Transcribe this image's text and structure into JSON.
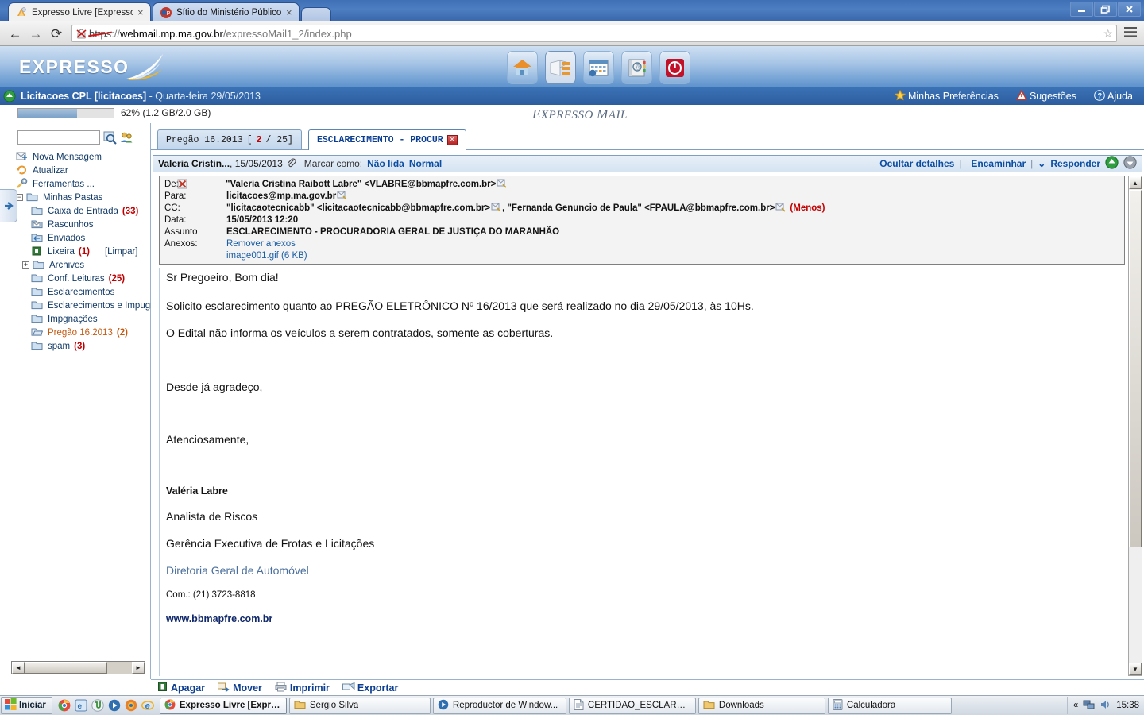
{
  "browser": {
    "tabs": [
      {
        "title": "Expresso Livre [Expresso Ma",
        "favicon": "expresso-favicon",
        "active": true,
        "close": "×"
      },
      {
        "title": "Sítio do Ministério Público do",
        "favicon": "mp-favicon",
        "active": false,
        "close": "×"
      }
    ],
    "newtab_label": "",
    "window_controls": {
      "minimize": "–",
      "maximize": "❐",
      "close": "✕"
    },
    "nav": {
      "back": "←",
      "forward": "→",
      "reload": "⟳"
    },
    "url": {
      "scheme": "https",
      "separator": "://",
      "host": "webmail.mp.ma.gov.br",
      "path": "/expressoMail1_2/index.php"
    },
    "bookmark_star": "☆",
    "menu": "☰"
  },
  "header": {
    "logo_text": "EXPRESSO",
    "toolbar_icons": [
      {
        "name": "home-icon",
        "selected": false
      },
      {
        "name": "mail-icon",
        "selected": true
      },
      {
        "name": "calendar-icon",
        "selected": false
      },
      {
        "name": "addressbook-icon",
        "selected": false
      },
      {
        "name": "logout-icon",
        "selected": false
      }
    ],
    "user": "Licitacoes CPL [licitacoes]",
    "date": " - Quarta-feira 29/05/2013",
    "links": [
      {
        "label": "Minhas Preferências",
        "icon": "star-icon"
      },
      {
        "label": "Sugestões",
        "icon": "warning-icon"
      },
      {
        "label": "Ajuda",
        "icon": "help-icon"
      }
    ]
  },
  "quota": {
    "percent": 62,
    "text": "62% (1.2 GB/2.0 GB)",
    "watermark_1": "E",
    "watermark_2": "XPRESSO ",
    "watermark_3": "M",
    "watermark_4": "AIL"
  },
  "sidebar": {
    "search_placeholder": "",
    "search_value": "",
    "icons": {
      "search": "search-icon",
      "contacts": "contacts-icon"
    },
    "items": [
      {
        "label": "Nova Mensagem",
        "icon": "new-message-icon",
        "indent": 0,
        "tree": "",
        "count": "",
        "extra": ""
      },
      {
        "label": "Atualizar",
        "icon": "refresh-icon",
        "indent": 0,
        "tree": "",
        "count": "",
        "extra": ""
      },
      {
        "label": "Ferramentas ...",
        "icon": "tools-icon",
        "indent": 0,
        "tree": "",
        "count": "",
        "extra": ""
      },
      {
        "label": "Minhas Pastas",
        "icon": "folder-icon",
        "indent": 0,
        "tree": "−",
        "count": "",
        "extra": ""
      },
      {
        "label": "Caixa de Entrada",
        "icon": "folder-icon",
        "indent": 1,
        "tree": "",
        "count": "(33)",
        "extra": ""
      },
      {
        "label": "Rascunhos",
        "icon": "drafts-icon",
        "indent": 1,
        "tree": "",
        "count": "",
        "extra": ""
      },
      {
        "label": "Enviados",
        "icon": "sent-icon",
        "indent": 1,
        "tree": "",
        "count": "",
        "extra": ""
      },
      {
        "label": "Lixeira",
        "icon": "trash-icon",
        "indent": 1,
        "tree": "",
        "count": "(1)",
        "extra": "[Limpar]"
      },
      {
        "label": "Archives",
        "icon": "folder-icon",
        "indent": 1,
        "tree": "+",
        "count": "",
        "extra": ""
      },
      {
        "label": "Conf. Leituras",
        "icon": "folder-icon",
        "indent": 1,
        "tree": "",
        "count": "(25)",
        "extra": ""
      },
      {
        "label": "Esclarecimentos",
        "icon": "folder-icon",
        "indent": 1,
        "tree": "",
        "count": "",
        "extra": ""
      },
      {
        "label": "Esclarecimentos e Impugr",
        "icon": "folder-icon",
        "indent": 1,
        "tree": "",
        "count": "",
        "extra": ""
      },
      {
        "label": "Impgnações",
        "icon": "folder-icon",
        "indent": 1,
        "tree": "",
        "count": "",
        "extra": ""
      },
      {
        "label": "Pregão 16.2013",
        "icon": "folder-open-icon",
        "indent": 1,
        "tree": "",
        "count": "(2)",
        "extra": "",
        "highlight": true
      },
      {
        "label": "spam",
        "icon": "folder-icon",
        "indent": 1,
        "tree": "",
        "count": "(3)",
        "extra": ""
      }
    ],
    "scroll_left": "◄",
    "scroll_right": "►",
    "collapse_arrow": "collapse-sidebar-icon"
  },
  "mail": {
    "tabs": [
      {
        "label": "Pregão 16.2013",
        "counter_open": "[",
        "counter_num": "2",
        "counter_rest": " / 25]",
        "active": false
      },
      {
        "label": "ESCLARECIMENTO - PROCUR",
        "active": true,
        "close": "✕"
      }
    ],
    "msgbar": {
      "from": "Valeria Cristin...",
      "date": ", 15/05/2013",
      "attachment_icon": "paperclip-icon",
      "mark_as_label": "Marcar como:",
      "mark_unread": "Não lida",
      "mark_normal": "Normal",
      "hide_details": "Ocultar detalhes",
      "sep1": "|",
      "forward": "Encaminhar",
      "sep2": "|",
      "reply_caret": "⌄",
      "reply": "Responder",
      "nav_up": "▲",
      "nav_down": "▼"
    },
    "details": {
      "rows": [
        {
          "label": "De:",
          "value": "\"Valeria Cristina Raibott Labre\" <VLABRE@bbmapfre.com.br>",
          "bold": true,
          "icon_after": true,
          "x_icon": true
        },
        {
          "label": "Para:",
          "value": "licitacoes@mp.ma.gov.br",
          "bold": true,
          "icon_after": true
        },
        {
          "label": "CC:",
          "value": "\"licitacaotecnicabb\" <licitacaotecnicabb@bbmapfre.com.br>",
          "value2": ", \"Fernanda Genuncio de Paula\" <FPAULA@bbmapfre.com.br>",
          "menos": "(Menos)",
          "bold": true,
          "icon_after": true
        },
        {
          "label": "Data:",
          "value": "15/05/2013 12:20",
          "bold": true
        },
        {
          "label": "Assunto",
          "value": "ESCLARECIMENTO - PROCURADORIA GERAL DE JUSTIÇA DO MARANHÃO",
          "bold": true
        },
        {
          "label": "Anexos:",
          "value": "Remover anexos",
          "value2": "image001.gif (6 KB)",
          "link": true
        }
      ]
    },
    "body": {
      "lines": [
        {
          "text": "Sr Pregoeiro, Bom dia!",
          "style": "normal"
        },
        {
          "text": "Solicito esclarecimento quanto ao PREGÃO ELETRÔNICO Nº 16/2013 que será realizado no dia 29/05/2013, às 10Hs.",
          "style": "normal"
        },
        {
          "text": "O Edital não informa os veículos a serem contratados, somente as coberturas.",
          "style": "normal"
        },
        {
          "text": "",
          "style": "blank"
        },
        {
          "text": "Desde já agradeço,",
          "style": "normal"
        },
        {
          "text": "",
          "style": "blank"
        },
        {
          "text": "Atenciosamente,",
          "style": "normal"
        },
        {
          "text": "",
          "style": "blank"
        },
        {
          "text": "Valéria Labre",
          "style": "bold-small"
        },
        {
          "text": "Analista de Riscos",
          "style": "normal"
        },
        {
          "text": "Gerência Executiva de Frotas e Licitações",
          "style": "normal"
        },
        {
          "text": "Diretoria Geral de Automóvel",
          "style": "link"
        },
        {
          "text": "Com.: (21) 3723-8818",
          "style": "small"
        },
        {
          "text": "www.bbmapfre.com.br",
          "style": "bold-small-dark"
        }
      ]
    },
    "actions": [
      {
        "label": "Apagar",
        "icon": "delete-icon"
      },
      {
        "label": "Mover",
        "icon": "move-icon"
      },
      {
        "label": "Imprimir",
        "icon": "print-icon"
      },
      {
        "label": "Exportar",
        "icon": "export-icon"
      }
    ],
    "scroll": {
      "up": "▲",
      "down": "▼"
    }
  },
  "taskbar": {
    "start_label": "Iniciar",
    "quicklaunch": [
      {
        "name": "chrome-icon"
      },
      {
        "name": "ie-tab-icon"
      },
      {
        "name": "utorrent-icon"
      },
      {
        "name": "media-player-icon"
      },
      {
        "name": "firefox-orb-icon"
      },
      {
        "name": "internet-explorer-icon"
      }
    ],
    "windows": [
      {
        "label": "Expresso Livre [Expre...",
        "icon": "chrome-icon",
        "active": true
      },
      {
        "label": "Sergio Silva",
        "icon": "folder-icon",
        "active": false
      },
      {
        "label": "Reproductor de Window...",
        "icon": "media-player-icon",
        "active": false
      },
      {
        "label": "CERTIDÃO_ESCLARECI...",
        "icon": "document-icon",
        "active": false
      },
      {
        "label": "Downloads",
        "icon": "folder-icon",
        "active": false
      },
      {
        "label": "Calculadora",
        "icon": "calculator-icon",
        "active": false
      }
    ],
    "tray": {
      "expand": "«",
      "icons": [
        "network-icon",
        "volume-icon"
      ],
      "clock": "15:38"
    }
  },
  "colors": {
    "accent_blue": "#2c5d9e",
    "link_blue": "#0b4da2",
    "count_red": "#c00000",
    "highlight_orange": "#c55a11"
  }
}
